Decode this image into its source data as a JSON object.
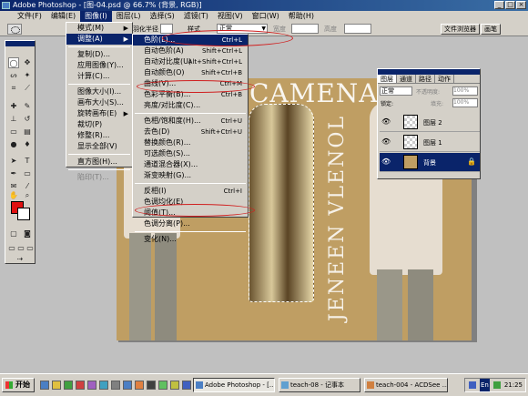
{
  "window": {
    "title": "Adobe Photoshop - [图-04.psd @ 66.7% (背景, RGB)]"
  },
  "menubar": {
    "items": [
      "文件(F)",
      "编辑(E)",
      "图像(I)",
      "图层(L)",
      "选择(S)",
      "滤镜(T)",
      "视图(V)",
      "窗口(W)",
      "帮助(H)"
    ]
  },
  "optbar": {
    "feather_label": "羽化半径",
    "feather_value": "0",
    "style_label": "样式",
    "style_value": "正常",
    "width_label": "宽度",
    "height_label": "高度",
    "tab_browser": "文件浏览器",
    "tab_brush": "画笔"
  },
  "image_menu": {
    "items": [
      {
        "label": "模式(M)",
        "sub": true
      },
      {
        "label": "调整(A)",
        "sub": true,
        "hl": true
      },
      {
        "sep": true
      },
      {
        "label": "复制(D)..."
      },
      {
        "label": "应用图像(Y)..."
      },
      {
        "label": "计算(C)..."
      },
      {
        "sep": true
      },
      {
        "label": "图像大小(I)..."
      },
      {
        "label": "画布大小(S)..."
      },
      {
        "label": "旋转画布(E)",
        "sub": true
      },
      {
        "label": "裁切(P)"
      },
      {
        "label": "修整(R)..."
      },
      {
        "label": "显示全部(V)"
      },
      {
        "sep": true
      },
      {
        "label": "直方图(H)..."
      },
      {
        "sep": true
      },
      {
        "label": "陷印(T)...",
        "dis": true
      }
    ]
  },
  "adjust_menu": {
    "items": [
      {
        "label": "色阶(L)...",
        "shortcut": "Ctrl+L",
        "hl": true
      },
      {
        "label": "自动色阶(A)",
        "shortcut": "Shift+Ctrl+L"
      },
      {
        "label": "自动对比度(U)",
        "shortcut": "Alt+Shift+Ctrl+L"
      },
      {
        "label": "自动颜色(O)",
        "shortcut": "Shift+Ctrl+B"
      },
      {
        "label": "曲线(V)...",
        "shortcut": "Ctrl+M"
      },
      {
        "label": "色彩平衡(B)...",
        "shortcut": "Ctrl+B"
      },
      {
        "label": "亮度/对比度(C)..."
      },
      {
        "sep": true
      },
      {
        "label": "色相/饱和度(H)...",
        "shortcut": "Ctrl+U"
      },
      {
        "label": "去色(D)",
        "shortcut": "Shift+Ctrl+U"
      },
      {
        "label": "替换颜色(R)..."
      },
      {
        "label": "可选颜色(S)..."
      },
      {
        "label": "通道混合器(X)..."
      },
      {
        "label": "渐变映射(G)..."
      },
      {
        "sep": true
      },
      {
        "label": "反相(I)",
        "shortcut": "Ctrl+I"
      },
      {
        "label": "色调均化(E)"
      },
      {
        "label": "阈值(T)..."
      },
      {
        "label": "色调分离(P)..."
      },
      {
        "sep": true
      },
      {
        "label": "变化(N)..."
      }
    ]
  },
  "photo": {
    "text_horizontal": "CAMENAC",
    "text_vertical": "JENEEN VLENOL"
  },
  "layers_panel": {
    "tabs": [
      "图层",
      "通道",
      "路径",
      "动作"
    ],
    "blend": "正常",
    "opacity_label": "不透明度:",
    "opacity": "100%",
    "lock_label": "锁定:",
    "fill_label": "填充:",
    "fill": "100%",
    "layers": [
      {
        "name": "图层 2",
        "selected": false
      },
      {
        "name": "图层 1",
        "selected": false
      },
      {
        "name": "背景",
        "selected": true
      }
    ]
  },
  "taskbar": {
    "start": "开始",
    "tasks": [
      {
        "label": "Adobe Photoshop - [...",
        "active": true
      },
      {
        "label": "teach-08 - 记事本",
        "active": false
      },
      {
        "label": "teach-004 - ACDSee ...",
        "active": false
      }
    ],
    "ime": "En",
    "clock": "21:25"
  },
  "colors": {
    "foreground": "#e01010",
    "background": "#ffffff",
    "annotation": "#d02020"
  }
}
